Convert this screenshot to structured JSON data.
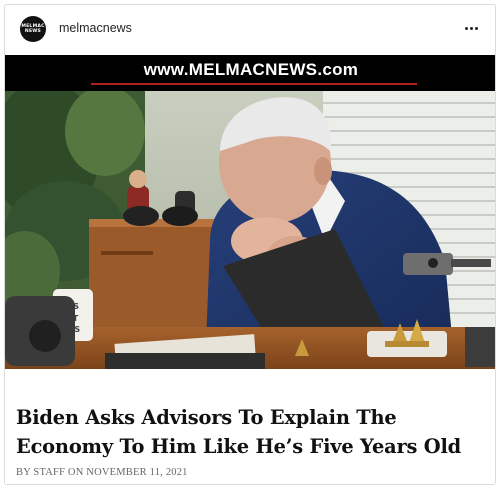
{
  "account": {
    "avatar_text_line1": "MELMAC",
    "avatar_text_line2": "NEWS",
    "username": "melmacnews"
  },
  "banner": {
    "site": "www.MELMACNEWS.com"
  },
  "photo": {
    "mug_text": "LD'S\nST\nSS"
  },
  "article": {
    "headline": "Biden Asks Advisors To Explain The Economy To Him Like He’s Five Years Old",
    "byline": "BY STAFF ON NOVEMBER 11, 2021"
  },
  "colors": {
    "banner_bg": "#000000",
    "banner_accent": "#b22020",
    "border": "#dbdbdb"
  },
  "icons": {
    "menu": "more-horizontal-icon"
  }
}
